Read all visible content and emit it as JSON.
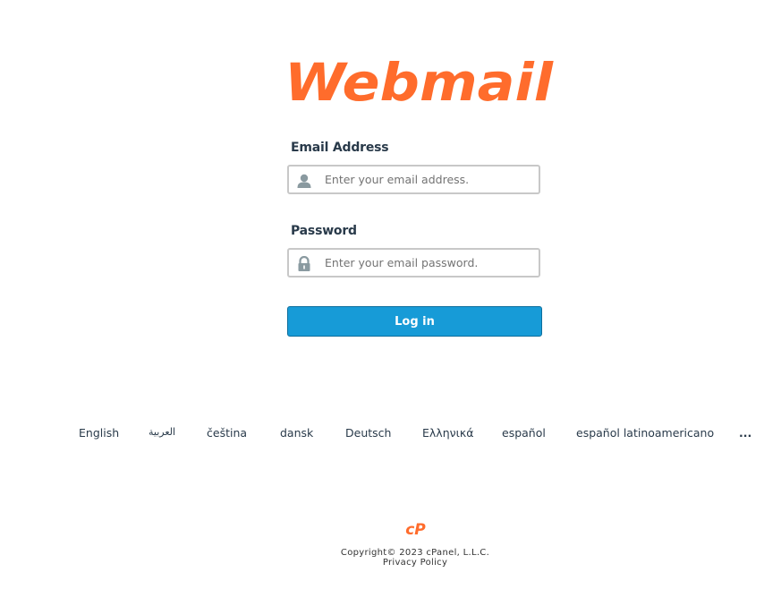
{
  "brand": {
    "logo_text": "Webmail",
    "accent_color": "#ff6c2c"
  },
  "form": {
    "email": {
      "label": "Email Address",
      "placeholder": "Enter your email address.",
      "value": "",
      "icon": "user-icon"
    },
    "password": {
      "label": "Password",
      "placeholder": "Enter your email password.",
      "value": "",
      "icon": "lock-icon"
    },
    "login_label": "Log in",
    "button_color": "#179bd7"
  },
  "languages": {
    "items": [
      "English",
      "العربية",
      "čeština",
      "dansk",
      "Deutsch",
      "Ελληνικά",
      "español",
      "español latinoamericano"
    ],
    "more_label": "..."
  },
  "footer": {
    "logo_icon": "cpanel-logo",
    "copyright": "Copyright© 2023 cPanel, L.L.C.",
    "privacy_label": "Privacy Policy"
  }
}
